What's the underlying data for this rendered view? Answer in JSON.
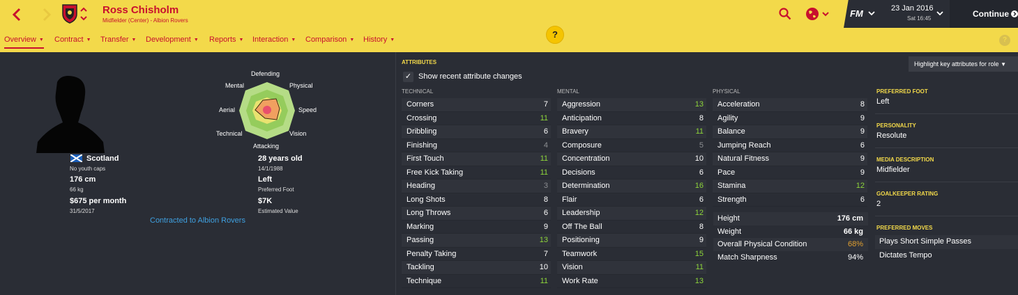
{
  "header": {
    "player_name": "Ross Chisholm",
    "player_subtitle": "Midfielder (Center) - Albion Rovers",
    "date": "23 Jan 2016",
    "time": "Sat 16:45",
    "fm_label": "FM",
    "continue_label": "Continue",
    "help_label": "?",
    "help_small_label": "?"
  },
  "tabs": [
    {
      "label": "Overview",
      "active": true
    },
    {
      "label": "Contract"
    },
    {
      "label": "Transfer"
    },
    {
      "label": "Development"
    },
    {
      "label": "Reports"
    },
    {
      "label": "Interaction"
    },
    {
      "label": "Comparison"
    },
    {
      "label": "History"
    }
  ],
  "profile": {
    "nation": "Scotland",
    "youth_caps": "No youth caps",
    "height": "176 cm",
    "weight": "66 kg",
    "wage": "$675 per month",
    "contract_end": "31/5/2017",
    "age": "28 years old",
    "dob": "14/1/1988",
    "foot": "Left",
    "foot_label": "Preferred Foot",
    "value": "$7K",
    "value_label": "Estimated Value",
    "contract_link": "Contracted to Albion Rovers"
  },
  "radar": {
    "labels": {
      "defending": "Defending",
      "physical": "Physical",
      "speed": "Speed",
      "vision": "Vision",
      "attacking": "Attacking",
      "technical": "Technical",
      "aerial": "Aerial",
      "mental": "Mental"
    }
  },
  "attributes": {
    "title": "ATTRIBUTES",
    "show_changes_label": "Show recent attribute changes",
    "highlight_label": "Highlight key attributes for role",
    "technical_head": "TECHNICAL",
    "mental_head": "MENTAL",
    "physical_head": "PHYSICAL",
    "technical": [
      {
        "name": "Corners",
        "value": "7"
      },
      {
        "name": "Crossing",
        "value": "11"
      },
      {
        "name": "Dribbling",
        "value": "6"
      },
      {
        "name": "Finishing",
        "value": "4"
      },
      {
        "name": "First Touch",
        "value": "11"
      },
      {
        "name": "Free Kick Taking",
        "value": "11"
      },
      {
        "name": "Heading",
        "value": "3"
      },
      {
        "name": "Long Shots",
        "value": "8"
      },
      {
        "name": "Long Throws",
        "value": "6"
      },
      {
        "name": "Marking",
        "value": "9"
      },
      {
        "name": "Passing",
        "value": "13"
      },
      {
        "name": "Penalty Taking",
        "value": "7"
      },
      {
        "name": "Tackling",
        "value": "10"
      },
      {
        "name": "Technique",
        "value": "11"
      }
    ],
    "mental": [
      {
        "name": "Aggression",
        "value": "13"
      },
      {
        "name": "Anticipation",
        "value": "8"
      },
      {
        "name": "Bravery",
        "value": "11"
      },
      {
        "name": "Composure",
        "value": "5"
      },
      {
        "name": "Concentration",
        "value": "10"
      },
      {
        "name": "Decisions",
        "value": "6"
      },
      {
        "name": "Determination",
        "value": "16"
      },
      {
        "name": "Flair",
        "value": "6"
      },
      {
        "name": "Leadership",
        "value": "12"
      },
      {
        "name": "Off The Ball",
        "value": "8"
      },
      {
        "name": "Positioning",
        "value": "9"
      },
      {
        "name": "Teamwork",
        "value": "15"
      },
      {
        "name": "Vision",
        "value": "11"
      },
      {
        "name": "Work Rate",
        "value": "13"
      }
    ],
    "physical": [
      {
        "name": "Acceleration",
        "value": "8"
      },
      {
        "name": "Agility",
        "value": "9"
      },
      {
        "name": "Balance",
        "value": "9"
      },
      {
        "name": "Jumping Reach",
        "value": "6"
      },
      {
        "name": "Natural Fitness",
        "value": "9"
      },
      {
        "name": "Pace",
        "value": "9"
      },
      {
        "name": "Stamina",
        "value": "12"
      },
      {
        "name": "Strength",
        "value": "6"
      }
    ],
    "physical_extra": [
      {
        "name": "Height",
        "value": "176 cm",
        "color": "#ffffff",
        "bold": true
      },
      {
        "name": "Weight",
        "value": "66 kg",
        "color": "#ffffff",
        "bold": true
      },
      {
        "name": "Overall Physical Condition",
        "value": "68%",
        "color": "#e0a030"
      },
      {
        "name": "Match Sharpness",
        "value": "94%",
        "color": "#ffffff"
      }
    ]
  },
  "info": {
    "preferred_foot_head": "PREFERRED FOOT",
    "preferred_foot": "Left",
    "personality_head": "PERSONALITY",
    "personality": "Resolute",
    "media_head": "MEDIA DESCRIPTION",
    "media": "Midfielder",
    "gk_head": "GOALKEEPER RATING",
    "gk": "2",
    "moves_head": "PREFERRED MOVES",
    "moves": [
      "Plays Short Simple Passes",
      "Dictates Tempo"
    ]
  },
  "colors": {
    "header_bg": "#f3d94a",
    "accent_red": "#c8102e",
    "body_bg": "#2a2d35",
    "attr_green": "#8ed63a",
    "attr_grey": "#8c8e92",
    "link_blue": "#3fa0e0"
  }
}
